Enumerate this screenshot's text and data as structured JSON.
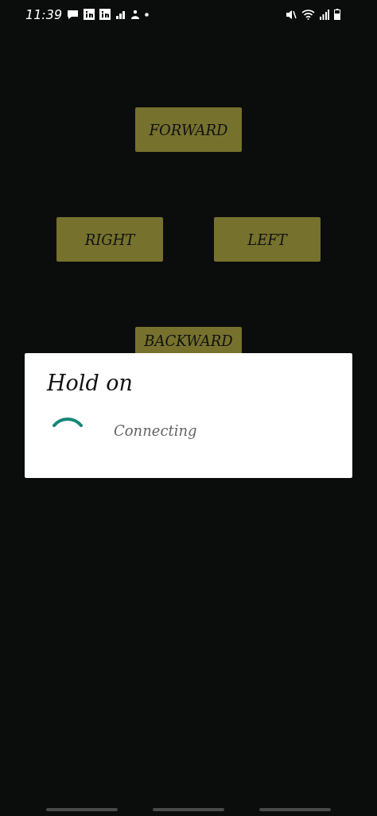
{
  "status_bar": {
    "time": "11:39"
  },
  "controls": [
    {
      "label": "FORWARD"
    },
    {
      "label": "RIGHT"
    },
    {
      "label": "LEFT"
    },
    {
      "label": "BACKWARD"
    }
  ],
  "dialog": {
    "title": "Hold on",
    "message": "Connecting"
  }
}
